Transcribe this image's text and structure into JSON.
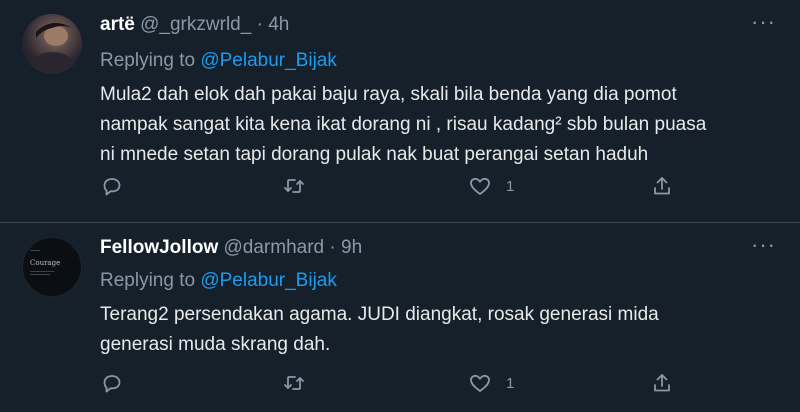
{
  "tweets": [
    {
      "name": "artë",
      "handle": "@_grkzwrld_",
      "separator": "·",
      "time": "4h",
      "replying_to_label": "Replying to",
      "replying_to": "@Pelabur_Bijak",
      "text_lines": [
        "Mula2 dah elok dah pakai baju raya, skali bila benda yang dia pomot",
        "nampak sangat kita kena ikat dorang ni , risau kadang² sbb bulan puasa",
        "ni mnede setan tapi dorang pulak nak buat perangai  setan haduh"
      ],
      "likes": "1",
      "more": "···"
    },
    {
      "name": "FellowJollow",
      "handle": "@darmhard",
      "separator": "·",
      "time": "9h",
      "avatar_text": "Courage",
      "replying_to_label": "Replying to",
      "replying_to": "@Pelabur_Bijak",
      "text_lines": [
        "Terang2 persendakan agama. JUDI diangkat, rosak generasi mida",
        "generasi muda skrang dah."
      ],
      "likes": "1",
      "more": "···"
    }
  ],
  "icons": [
    "reply-icon",
    "retweet-icon",
    "like-icon",
    "share-icon",
    "more-icon"
  ]
}
